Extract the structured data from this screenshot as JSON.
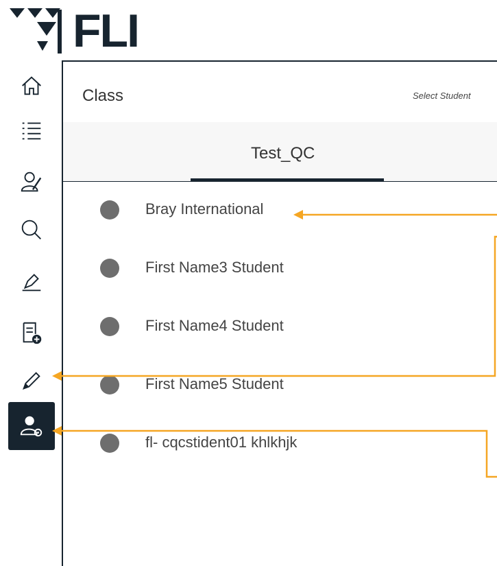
{
  "logo": {
    "text": "FLI"
  },
  "sidebar": {
    "items": [
      {
        "icon": "home-icon"
      },
      {
        "icon": "list-icon"
      },
      {
        "icon": "student-edit-icon"
      },
      {
        "icon": "search-icon"
      },
      {
        "icon": "pen-icon"
      },
      {
        "icon": "add-document-icon"
      },
      {
        "icon": "pencil-icon"
      },
      {
        "icon": "user-settings-icon",
        "active": true
      }
    ]
  },
  "header": {
    "title": "Class",
    "select_label": "Select Student"
  },
  "tabs": [
    {
      "label": "Test_QC",
      "active": true
    }
  ],
  "students": [
    {
      "name": "Bray International"
    },
    {
      "name": "First Name3 Student"
    },
    {
      "name": "First Name4 Student"
    },
    {
      "name": "First Name5 Student"
    },
    {
      "name": "fl- cqcstident01 khlkhjk"
    }
  ],
  "colors": {
    "brand": "#17242f",
    "annotation": "#f5a623",
    "dot": "#6e6e6e"
  }
}
